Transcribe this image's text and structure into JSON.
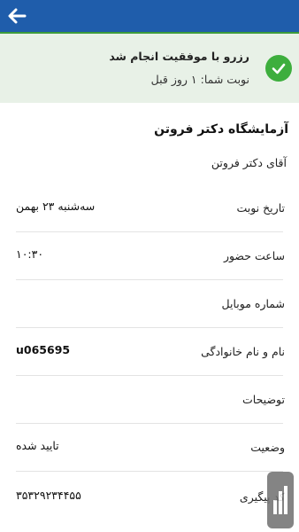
{
  "header": {
    "back_icon": "arrow-left-icon",
    "color": "#1f5dab"
  },
  "banner": {
    "title": "رزرو با موفقیت انجام شد",
    "subtitle": "نوبت شما: ۱ روز قبل",
    "icon": "check-circle-icon",
    "accent": "#3dae3d",
    "background": "#e8f1e7"
  },
  "appointment": {
    "lab_name": "آزمایشگاه دکتر فروتن",
    "doctor": "آقای دکتر فروتن",
    "rows": [
      {
        "label": "تاریخ نوبت",
        "value": "سه‌شنبه ۲۳ بهمن"
      },
      {
        "label": "ساعت حضور",
        "value": "۱۰:۳۰"
      },
      {
        "label": "شماره موبایل",
        "value": ""
      },
      {
        "label": "نام و نام خانوادگی",
        "value": "u065695"
      },
      {
        "label": "توضیحات",
        "value": ""
      },
      {
        "label": "وضعیت",
        "value": "تایید شده"
      },
      {
        "label": "کد پیگیری",
        "value": "۳۵۳۲۹۲۳۴۴۵۵"
      }
    ]
  },
  "floating": {
    "icon": "chart-bars-icon"
  }
}
